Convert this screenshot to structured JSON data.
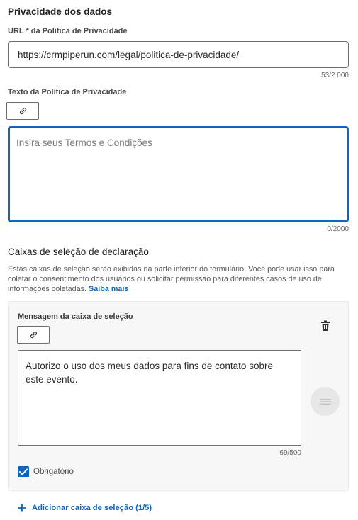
{
  "privacy": {
    "section_title": "Privacidade dos dados",
    "url_label": "URL * da Política de Privacidade",
    "url_value": "https://crmpiperun.com/legal/politica-de-privacidade/",
    "url_counter": "53/2.000",
    "text_label": "Texto da Política de Privacidade",
    "terms_placeholder": "Insira seus Termos e Condições",
    "terms_counter": "0/2000"
  },
  "declaration": {
    "title": "Caixas de seleção de declaração",
    "help_text": "Estas caixas de seleção serão exibidas na parte inferior do formulário. Você pode usar isso para coletar o consentimento dos usuários ou solicitar permissão para diferentes casos de uso de informações coletadas.",
    "learn_more": "Saiba mais",
    "card": {
      "label": "Mensagem da caixa de seleção",
      "message": "Autorizo o uso dos meus dados para fins de contato sobre este evento.",
      "counter": "69/500",
      "required_label": "Obrigatório",
      "required_checked": true
    },
    "add_label": "Adicionar caixa de seleção (1/5)"
  },
  "colors": {
    "accent": "#0a66c2"
  },
  "icons": {
    "link": "link-icon",
    "trash": "trash-icon",
    "drag": "drag-handle-icon",
    "check": "checkmark-icon",
    "plus": "plus-icon"
  }
}
